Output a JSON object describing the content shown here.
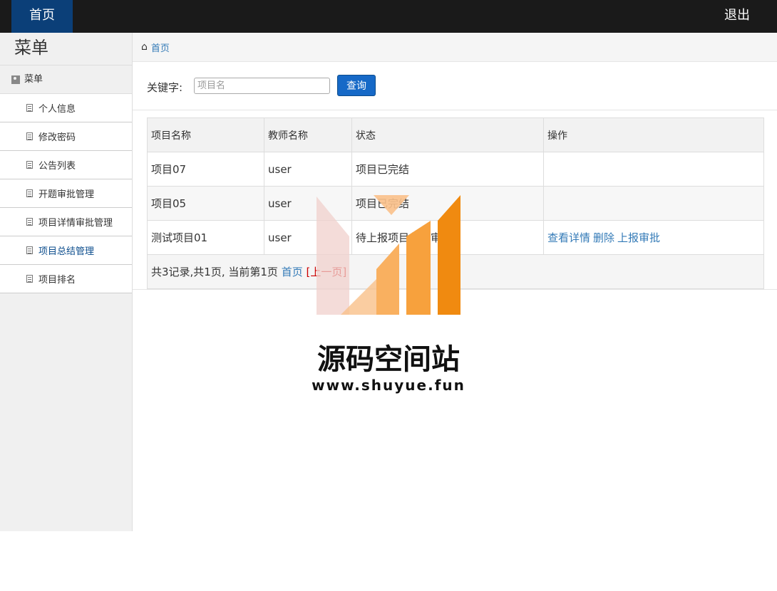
{
  "topbar": {
    "home_label": "首页",
    "logout_label": "退出"
  },
  "sidebar": {
    "title": "菜单",
    "group_label": "菜单",
    "items": [
      {
        "label": "个人信息",
        "active": false
      },
      {
        "label": "修改密码",
        "active": false
      },
      {
        "label": "公告列表",
        "active": false
      },
      {
        "label": "开题审批管理",
        "active": false
      },
      {
        "label": "项目详情审批管理",
        "active": false
      },
      {
        "label": "项目总结管理",
        "active": true
      },
      {
        "label": "项目排名",
        "active": false
      }
    ]
  },
  "breadcrumb": {
    "home": "首页"
  },
  "search": {
    "label": "关键字:",
    "placeholder": "项目名",
    "value": "",
    "button": "查询"
  },
  "table": {
    "headers": [
      "项目名称",
      "教师名称",
      "状态",
      "操作"
    ],
    "rows": [
      {
        "name": "项目07",
        "teacher": "user",
        "status": "项目已完结",
        "ops": []
      },
      {
        "name": "项目05",
        "teacher": "user",
        "status": "项目已完结",
        "ops": []
      },
      {
        "name": "测试项目01",
        "teacher": "user",
        "status": "待上报项目总结审核",
        "ops": [
          "查看详情",
          "删除",
          "上报审批"
        ]
      }
    ],
    "pager": {
      "summary": "共3记录,共1页, 当前第1页",
      "first": "首页",
      "rest": "[上一页]"
    }
  },
  "watermark": {
    "title": "源码空间站",
    "url": "www.shuyue.fun",
    "colors": [
      "#f0d0cc",
      "#f9c08a",
      "#f7a13d",
      "#f08a10"
    ]
  }
}
